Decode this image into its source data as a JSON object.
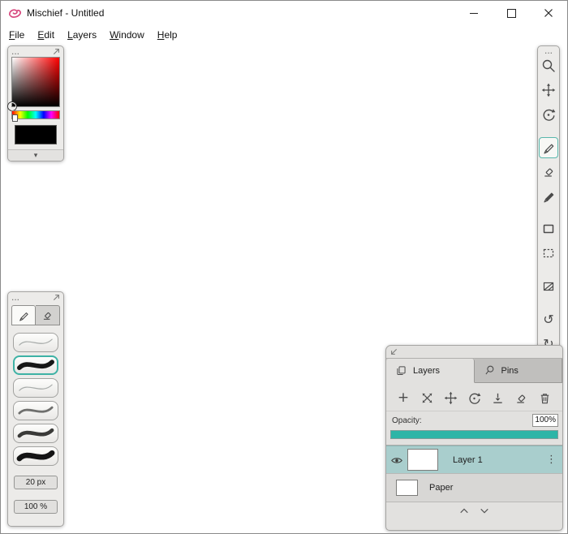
{
  "window": {
    "title": "Mischief - Untitled"
  },
  "menu": {
    "items": [
      {
        "label": "File"
      },
      {
        "label": "Edit"
      },
      {
        "label": "Layers"
      },
      {
        "label": "Window"
      },
      {
        "label": "Help"
      }
    ]
  },
  "icons": {
    "panel_handle": "...",
    "collapse_arrow": "▾",
    "undo": "↺",
    "redo": "↻",
    "add_layer": "+",
    "layer_menu": "⋮",
    "nav_up": "︿",
    "nav_down": "﹀"
  },
  "color_panel": {
    "current_color": "#000000"
  },
  "brush_panel": {
    "size_value": "20 px",
    "opacity_value": "100 %",
    "brushes": [
      {
        "width": 1.4,
        "color": "#a7aba9",
        "selected": false
      },
      {
        "width": 6.5,
        "color": "#161616",
        "selected": true
      },
      {
        "width": 1.4,
        "color": "#a7aba9",
        "selected": false
      },
      {
        "width": 3.2,
        "color": "#6f6f6d",
        "selected": false
      },
      {
        "width": 5.2,
        "color": "#3a3a38",
        "selected": false
      },
      {
        "width": 7.5,
        "color": "#141414",
        "selected": false
      }
    ]
  },
  "layers_panel": {
    "tabs": [
      {
        "label": "Layers",
        "selected": true
      },
      {
        "label": "Pins",
        "selected": false
      }
    ],
    "opacity_label": "Opacity:",
    "opacity_value": "100%",
    "opacity_percent": 100,
    "layers": [
      {
        "name": "Layer 1",
        "selected": true
      },
      {
        "name": "Paper",
        "selected": false
      }
    ]
  },
  "colors": {
    "accent_teal": "#2db5a7",
    "selected_layer": "#a9cecd",
    "current_color": "#000000"
  }
}
